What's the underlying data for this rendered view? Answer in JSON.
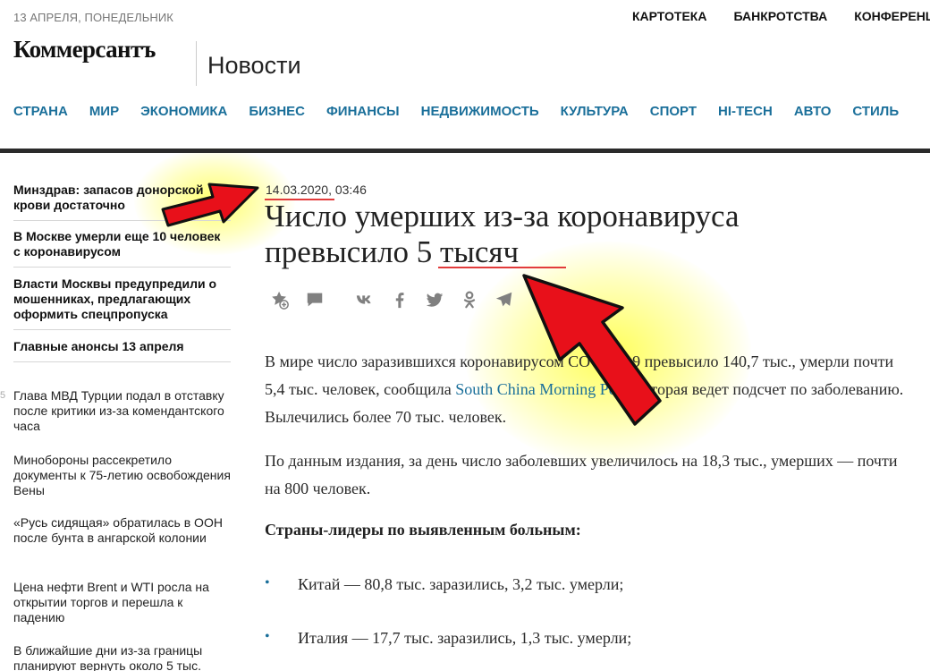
{
  "header": {
    "date": "13 АПРЕЛЯ, ПОНЕДЕЛЬНИК",
    "top_links": [
      "КАРТОТЕКА",
      "БАНКРОТСТВА",
      "КОНФЕРЕНЦИИ"
    ],
    "logo": "Коммерсантъ",
    "section": "Новости"
  },
  "nav": [
    "СТРАНА",
    "МИР",
    "ЭКОНОМИКА",
    "БИЗНЕС",
    "ФИНАНСЫ",
    "НЕДВИЖИМОСТЬ",
    "КУЛЬТУРА",
    "СПОРТ",
    "HI-TECH",
    "АВТО",
    "СТИЛЬ"
  ],
  "sidebar": {
    "top_stories": [
      "Минздрав: запасов донорской крови достаточно",
      "В Москве умерли еще 10 человек с коронавирусом",
      "Власти Москвы предупредили о мошенниках, предлагающих оформить спецпропуска",
      "Главные анонсы 13 апреля"
    ],
    "news": [
      {
        "tick": "5",
        "text": "Глава МВД Турции подал в отставку после критики из-за комендантского часа"
      },
      {
        "tick": "",
        "text": "Минобороны рассекретило документы к 75-летию освобождения Вены"
      },
      {
        "tick": "",
        "text": "«Русь сидящая» обратилась в ООН после бунта в ангарской колонии"
      },
      {
        "tick": "",
        "text": "Цена нефти Brent и WTI росла на открытии торгов и перешла к падению"
      },
      {
        "tick": "",
        "text": "В ближайшие дни из-за границы планируют вернуть около 5 тыс."
      }
    ]
  },
  "article": {
    "date": "14.03.2020",
    "time": ", 03:46",
    "headline": "Число умерших из-за коронавируса превысило 5 тысяч",
    "para1_a": "В мире число заразившихся коронавирусом COVID-19 превысило 140,7 тыс., умерли почти 5,4 тыс. человек, сообщила ",
    "para1_link": "South China Morning Post",
    "para1_b": ", которая ведет подсчет по заболеванию. Вылечились более 70 тыс. человек.",
    "para2": "По данным издания, за день число заболевших увеличилось на 18,3 тыс., умерших — почти на 800 человек.",
    "subhead": "Страны-лидеры по выявленным больным:",
    "bullets": [
      "Китай — 80,8 тыс. заразились, 3,2 тыс. умерли;",
      "Италия — 17,7 тыс. заразились, 1,3 тыс. умерли;"
    ]
  },
  "share_icons": [
    "favorite-add-icon",
    "comment-icon",
    "vk-icon",
    "facebook-icon",
    "twitter-icon",
    "odnoklassniki-icon",
    "telegram-icon"
  ],
  "colors": {
    "accent": "#1a6f9a",
    "annotation_red": "#e8101a",
    "highlight": "#ffff66"
  }
}
